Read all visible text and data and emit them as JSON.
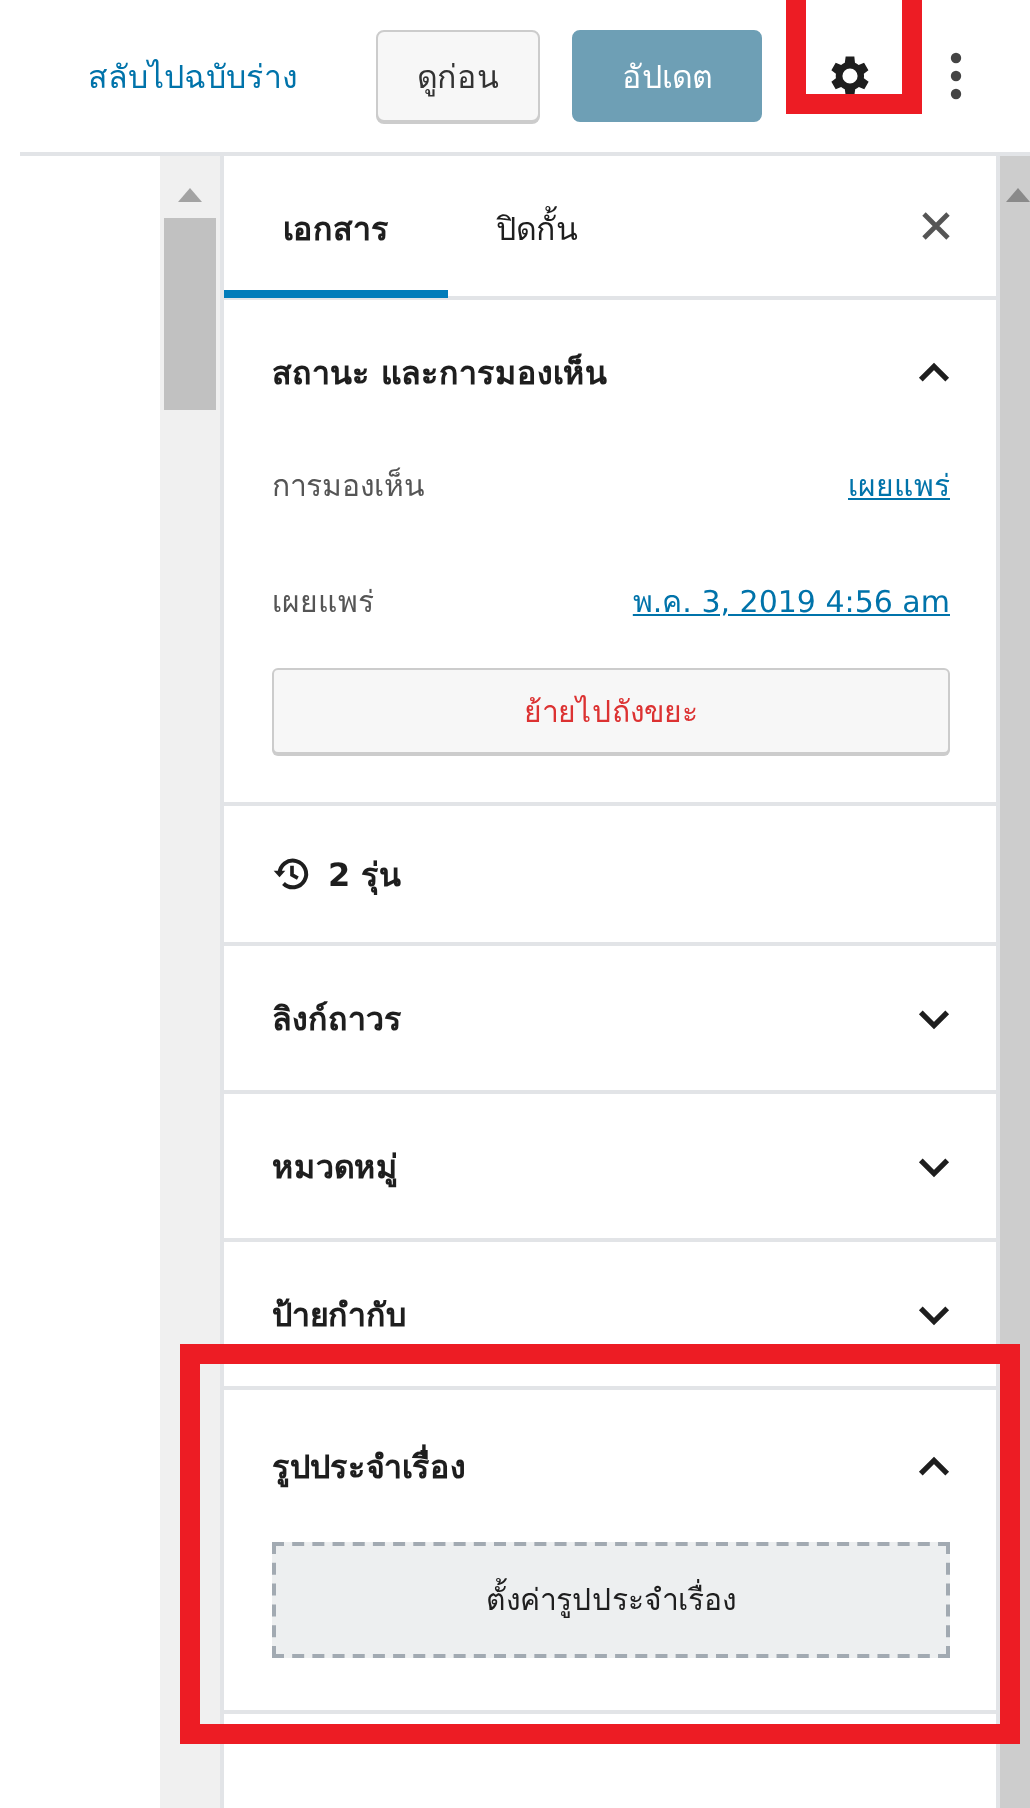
{
  "header": {
    "switch_to_draft": "สลับไปฉบับร่าง",
    "preview": "ดูก่อน",
    "update": {
      "label": "อัปเดต",
      "disabled": true
    },
    "settings": {
      "highlighted": true
    }
  },
  "sidebar": {
    "tabs": [
      {
        "label": "เอกสาร",
        "selected": true
      },
      {
        "label": "ปิดกั้น",
        "selected": false
      }
    ],
    "panels": [
      {
        "kind": "status",
        "title": "สถานะ และการมองเห็น",
        "expanded": true,
        "highlighted": false,
        "rows": [
          {
            "label": "การมองเห็น",
            "value": "เผยแพร่"
          },
          {
            "label": "เผยแพร่",
            "value": "พ.ค. 3, 2019 4:56 am"
          }
        ],
        "action": "ย้ายไปถังขยะ"
      },
      {
        "kind": "revisions",
        "title": "2 รุ่น",
        "highlighted": false
      },
      {
        "kind": "toggle",
        "title": "ลิงก์ถาวร",
        "expanded": false,
        "highlighted": false
      },
      {
        "kind": "toggle",
        "title": "หมวดหมู่",
        "expanded": false,
        "highlighted": false
      },
      {
        "kind": "toggle",
        "title": "ป้ายกำกับ",
        "expanded": false,
        "highlighted": false
      },
      {
        "kind": "featured",
        "title": "รูปประจำเรื่อง",
        "expanded": true,
        "highlighted": true,
        "action": "ตั้งค่ารูปประจำเรื่อง"
      }
    ]
  }
}
